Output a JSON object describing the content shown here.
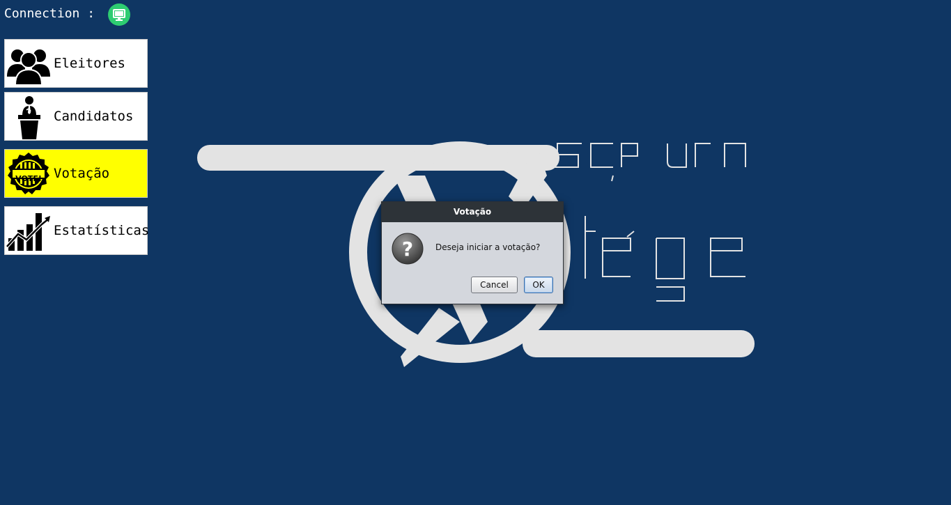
{
  "connection": {
    "label": "Connection :",
    "status_icon": "monitor-icon",
    "status_color": "#2ecc71"
  },
  "menu": {
    "items": [
      {
        "label": "Eleitores",
        "icon": "voters-group-icon",
        "active": false
      },
      {
        "label": "Candidatos",
        "icon": "candidate-podium-icon",
        "active": false
      },
      {
        "label": "Votação",
        "icon": "vote-badge-icon",
        "active": true
      },
      {
        "label": "Estatísticas",
        "icon": "stats-chart-icon",
        "active": false
      }
    ],
    "active_color": "#ffff00"
  },
  "logo": {
    "icon": "scp-urn-elege-logo"
  },
  "dialog": {
    "title": "Votação",
    "message": "Deseja iniciar a votação?",
    "icon": "question-icon",
    "cancel_label": "Cancel",
    "ok_label": "OK"
  },
  "colors": {
    "background": "#0f3663",
    "dialog_title_bar": "#2d3338"
  }
}
